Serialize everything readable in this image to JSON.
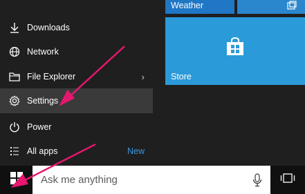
{
  "menu": {
    "items": [
      {
        "label": "Downloads",
        "icon": "download-icon"
      },
      {
        "label": "Network",
        "icon": "network-icon"
      },
      {
        "label": "File Explorer",
        "icon": "folder-icon",
        "chevron": "›"
      },
      {
        "label": "Settings",
        "icon": "gear-icon"
      },
      {
        "label": "Power",
        "icon": "power-icon"
      },
      {
        "label": "All apps",
        "icon": "list-icon",
        "badge": "New"
      }
    ]
  },
  "tiles": {
    "weather_label": "Weather",
    "store_label": "Store"
  },
  "taskbar": {
    "search_placeholder": "Ask me anything"
  },
  "colors": {
    "accent": "#2b9ad9",
    "arrow": "#e6176e",
    "badge": "#3c97db"
  }
}
